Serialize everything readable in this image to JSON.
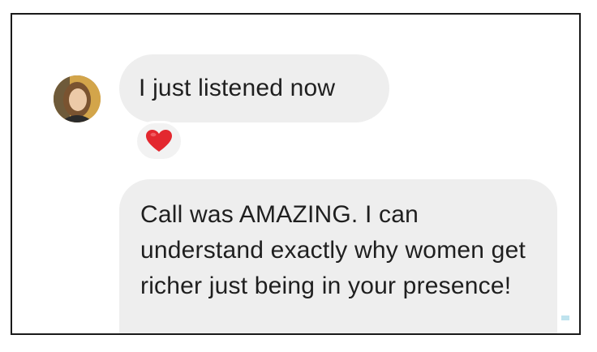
{
  "conversation": {
    "messages": [
      {
        "text": "I just listened now",
        "reaction": "heart-emoji"
      },
      {
        "text": "Call was AMAZING. I can understand exactly why women get richer just being in your presence!"
      }
    ]
  },
  "colors": {
    "bubble_bg": "#eeeeee",
    "text": "#1f1f1f",
    "heart": "#e3282f",
    "frame_border": "#1a1a1a"
  }
}
